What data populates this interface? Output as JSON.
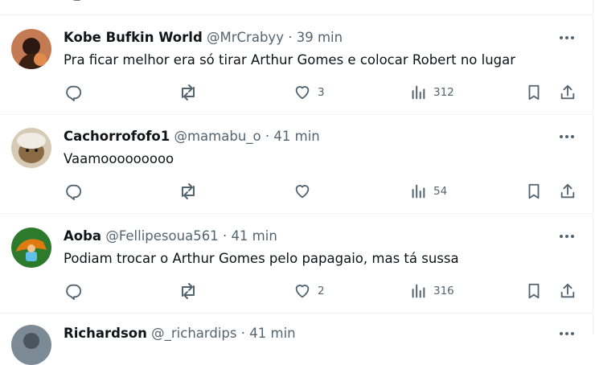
{
  "posts": [
    {
      "name": "Kobe Bufkin World",
      "handle": "@MrCrabyy",
      "time": "39 min",
      "text": "Pra ficar melhor era só tirar Arthur Gomes e colocar Robert no lugar",
      "likes": "3",
      "views": "312",
      "avatar_colors": [
        "#c47a52",
        "#2b1810",
        "#e08a4e"
      ]
    },
    {
      "name": "Cachorrofofo1",
      "handle": "@mamabu_o",
      "time": "41 min",
      "text": "Vaamooooooooo",
      "likes": "",
      "views": "54",
      "avatar_colors": [
        "#d7cab5",
        "#8a6a45",
        "#f0ece4"
      ]
    },
    {
      "name": "Aoba",
      "handle": "@Fellipesoua561",
      "time": "41 min",
      "text": "Podiam trocar o Arthur Gomes pelo papagaio, mas tá sussa",
      "likes": "2",
      "views": "316",
      "avatar_colors": [
        "#2d7a2d",
        "#e07a10",
        "#5fc0e8"
      ]
    }
  ],
  "partial_post": {
    "name": "Richardson",
    "handle": "@_richardips",
    "time": "41 min"
  },
  "separator": "·",
  "icons": {
    "reply": "reply-icon",
    "repost": "repost-icon",
    "like": "heart-icon",
    "views": "views-icon",
    "bookmark": "bookmark-icon",
    "share": "share-icon",
    "more": "more-icon"
  },
  "colors": {
    "primary_text": "#0f1419",
    "secondary_text": "#536471",
    "divider": "#eff3f4",
    "background": "#ffffff"
  }
}
